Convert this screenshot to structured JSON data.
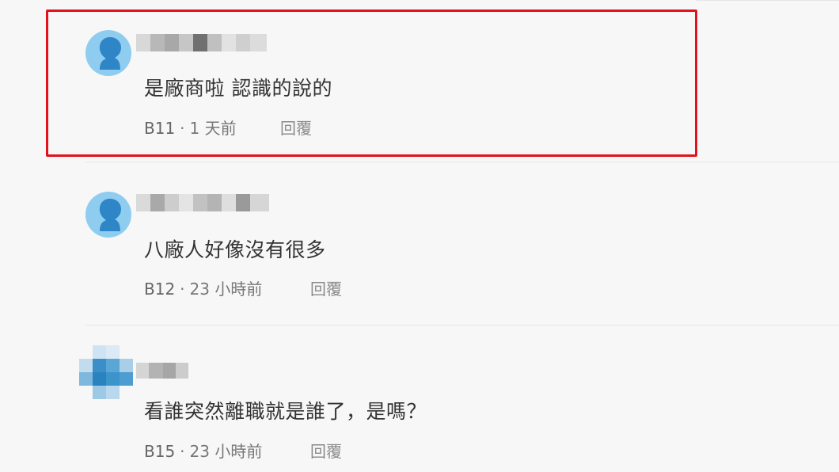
{
  "comments": [
    {
      "text": "是廠商啦 認識的說的",
      "floor": "B11",
      "separator": "·",
      "time": "1 天前",
      "reply_label": "回覆",
      "highlighted": true
    },
    {
      "text": "八廠人好像沒有很多",
      "floor": "B12",
      "separator": "·",
      "time": "23 小時前",
      "reply_label": "回覆",
      "highlighted": false
    },
    {
      "text": "看誰突然離職就是誰了，是嗎？",
      "floor": "B15",
      "separator": "·",
      "time": "23 小時前",
      "reply_label": "回覆",
      "highlighted": false
    }
  ],
  "colors": {
    "background": "#f7f7f7",
    "highlight_border": "#e3111b",
    "avatar_default": "#8fcdf0",
    "text": "#333333",
    "meta": "#777777"
  },
  "icons": {
    "default_avatar": "user-silhouette-icon"
  }
}
